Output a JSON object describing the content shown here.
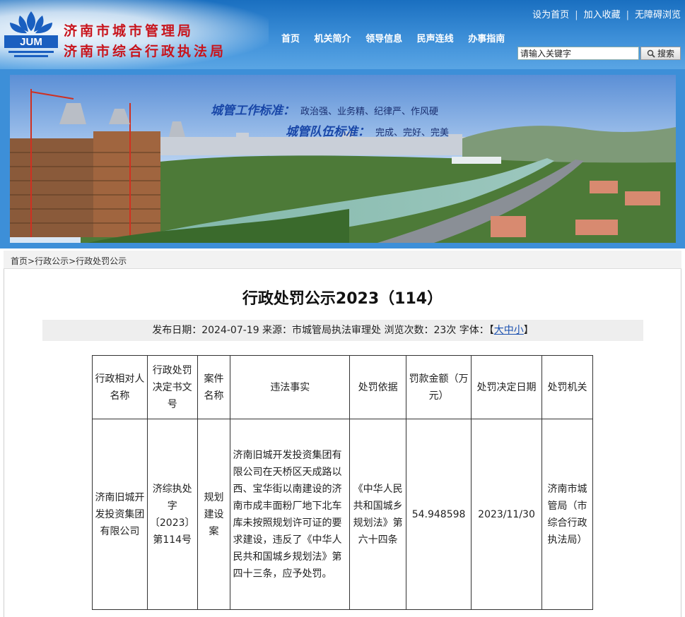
{
  "header": {
    "site_name_line1": "济南市城市管理局",
    "site_name_line2": "济南市综合行政执法局",
    "logo_text": "JUM",
    "top_links": [
      "设为首页",
      "加入收藏",
      "无障碍浏览"
    ],
    "nav": [
      "首页",
      "机关简介",
      "领导信息",
      "民声连线",
      "办事指南"
    ],
    "search": {
      "placeholder": "请输入关键字",
      "value": "请输入关键字",
      "button": "搜索",
      "button_icon": "magnifier-icon"
    }
  },
  "banner": {
    "motto1_title": "城管工作标准：",
    "motto1_body": "政治强、业务精、纪律严、作风硬",
    "motto2_title": "城管队伍标准：",
    "motto2_body": "完成、完好、完美"
  },
  "breadcrumb": [
    "首页",
    "行政公示",
    "行政处罚公示"
  ],
  "breadcrumb_sep": ">",
  "article": {
    "title": "行政处罚公示2023（114）",
    "meta_prefix": "发布日期：2024-07-19 来源：市城管局执法审理处 浏览次数：23次 字体：【",
    "font_size_link": "大中小",
    "meta_suffix": "】"
  },
  "table": {
    "headers": [
      "行政相对人名称",
      "行政处罚决定书文号",
      "案件名称",
      "违法事实",
      "处罚依据",
      "罚款金额（万元）",
      "处罚决定日期",
      "处罚机关"
    ],
    "row": [
      "济南旧城开发投资集团有限公司",
      "济综执处字〔2023〕第114号",
      "规划建设案",
      "济南旧城开发投资集团有限公司在天桥区天成路以西、宝华街以南建设的济南市成丰面粉厂地下北车库未按照规划许可证的要求建设，违反了《中华人民共和国城乡规划法》第四十三条，应予处罚。",
      "《中华人民共和国城乡规划法》第六十四条",
      "54.948598",
      "2023/11/30",
      "济南市城管局（市综合行政执法局）"
    ]
  },
  "colors": {
    "header_blue": "#3d8fd8",
    "site_name_red": "#c8141c",
    "motto_blue": "#1947a8"
  }
}
